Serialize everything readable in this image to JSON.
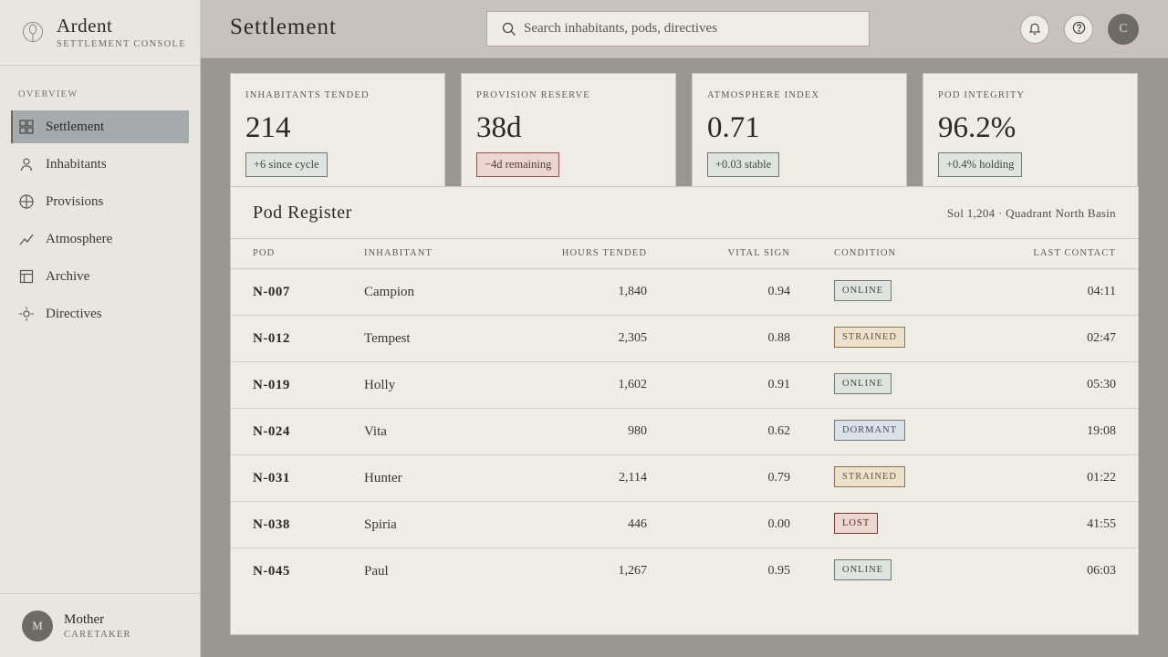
{
  "brand": {
    "name": "Ardent",
    "subtitle": "SETTLEMENT CONSOLE"
  },
  "sidebar": {
    "section": "OVERVIEW",
    "items": [
      {
        "label": "Settlement",
        "icon": "grid-icon",
        "active": true
      },
      {
        "label": "Inhabitants",
        "icon": "person-icon",
        "active": false
      },
      {
        "label": "Provisions",
        "icon": "globe-icon",
        "active": false
      },
      {
        "label": "Atmosphere",
        "icon": "trend-icon",
        "active": false
      },
      {
        "label": "Archive",
        "icon": "layout-icon",
        "active": false
      },
      {
        "label": "Directives",
        "icon": "sun-icon",
        "active": false
      }
    ]
  },
  "user": {
    "initial": "M",
    "name": "Mother",
    "role": "CARETAKER"
  },
  "header": {
    "title": "Settlement",
    "search_placeholder": "Search inhabitants, pods, directives",
    "avatar_initial": "C"
  },
  "stats": [
    {
      "label": "INHABITANTS TENDED",
      "value": "214",
      "badge": "+6 since cycle",
      "tone": "pos"
    },
    {
      "label": "PROVISION RESERVE",
      "value": "38d",
      "badge": "−4d remaining",
      "tone": "neg"
    },
    {
      "label": "ATMOSPHERE INDEX",
      "value": "0.71",
      "badge": "+0.03 stable",
      "tone": "pos"
    },
    {
      "label": "POD INTEGRITY",
      "value": "96.2%",
      "badge": "+0.4% holding",
      "tone": "pos"
    }
  ],
  "register": {
    "title": "Pod Register",
    "meta": "Sol 1,204 · Quadrant North Basin",
    "columns": [
      "POD",
      "INHABITANT",
      "HOURS TENDED",
      "VITAL SIGN",
      "CONDITION",
      "LAST CONTACT"
    ],
    "rows": [
      {
        "pod": "N-007",
        "inhabitant": "Campion",
        "hours": "1,840",
        "vital": "0.94",
        "condition": "ONLINE",
        "kind": "online",
        "last": "04:11"
      },
      {
        "pod": "N-012",
        "inhabitant": "Tempest",
        "hours": "2,305",
        "vital": "0.88",
        "condition": "STRAINED",
        "kind": "strained",
        "last": "02:47"
      },
      {
        "pod": "N-019",
        "inhabitant": "Holly",
        "hours": "1,602",
        "vital": "0.91",
        "condition": "ONLINE",
        "kind": "online",
        "last": "05:30"
      },
      {
        "pod": "N-024",
        "inhabitant": "Vita",
        "hours": "980",
        "vital": "0.62",
        "condition": "DORMANT",
        "kind": "dormant",
        "last": "19:08"
      },
      {
        "pod": "N-031",
        "inhabitant": "Hunter",
        "hours": "2,114",
        "vital": "0.79",
        "condition": "STRAINED",
        "kind": "strained",
        "last": "01:22"
      },
      {
        "pod": "N-038",
        "inhabitant": "Spiria",
        "hours": "446",
        "vital": "0.00",
        "condition": "LOST",
        "kind": "lost",
        "last": "41:55"
      },
      {
        "pod": "N-045",
        "inhabitant": "Paul",
        "hours": "1,267",
        "vital": "0.95",
        "condition": "ONLINE",
        "kind": "online",
        "last": "06:03"
      }
    ]
  }
}
